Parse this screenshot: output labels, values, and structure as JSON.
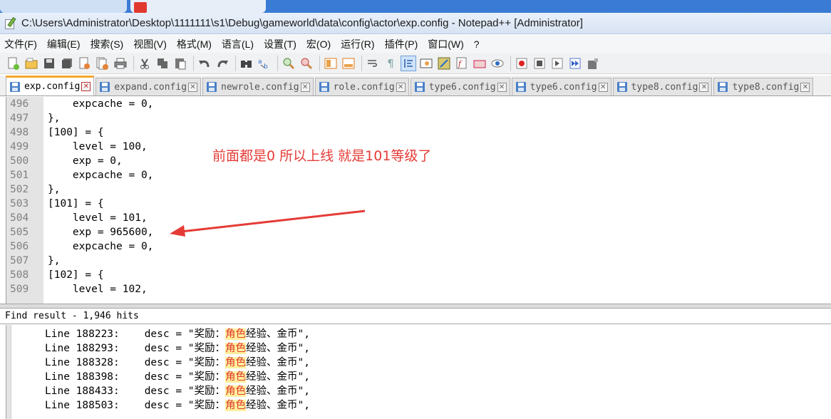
{
  "window": {
    "title": "C:\\Users\\Administrator\\Desktop\\1111111\\s1\\Debug\\gameworld\\data\\config\\actor\\exp.config - Notepad++ [Administrator]"
  },
  "menu": [
    "文件(F)",
    "编辑(E)",
    "搜索(S)",
    "视图(V)",
    "格式(M)",
    "语言(L)",
    "设置(T)",
    "宏(O)",
    "运行(R)",
    "插件(P)",
    "窗口(W)",
    "?"
  ],
  "toolbar": {
    "icons": [
      "new-file-icon",
      "open-file-icon",
      "save-icon",
      "save-all-icon",
      "close-icon",
      "close-all-icon",
      "print-icon",
      "cut-icon",
      "copy-icon",
      "paste-icon",
      "undo-icon",
      "redo-icon",
      "find-icon",
      "replace-icon",
      "zoom-in-icon",
      "zoom-out-icon",
      "sync-vertical-icon",
      "sync-horizontal-icon",
      "word-wrap-icon",
      "show-all-chars-icon",
      "indent-guide-icon",
      "user-language-icon",
      "document-map-icon",
      "function-list-icon",
      "folder-workspace-icon",
      "monitoring-icon",
      "record-macro-icon",
      "stop-macro-icon",
      "playback-macro-icon",
      "run-macro-multiple-icon",
      "save-macro-icon"
    ]
  },
  "tabs": [
    {
      "label": "exp.config",
      "active": true
    },
    {
      "label": "expand.config",
      "active": false
    },
    {
      "label": "newrole.config",
      "active": false
    },
    {
      "label": "role.config",
      "active": false
    },
    {
      "label": "type6.config",
      "active": false
    },
    {
      "label": "type6.config",
      "active": false
    },
    {
      "label": "type8.config",
      "active": false
    },
    {
      "label": "type8.config",
      "active": false
    }
  ],
  "editor": {
    "lines": [
      {
        "n": "496",
        "text": "    expcache = 0,"
      },
      {
        "n": "497",
        "text": "},"
      },
      {
        "n": "498",
        "text": "[100] = {"
      },
      {
        "n": "499",
        "text": "    level = 100,"
      },
      {
        "n": "500",
        "text": "    exp = 0,"
      },
      {
        "n": "501",
        "text": "    expcache = 0,"
      },
      {
        "n": "502",
        "text": "},"
      },
      {
        "n": "503",
        "text": "[101] = {"
      },
      {
        "n": "504",
        "text": "    level = 101,"
      },
      {
        "n": "505",
        "text": "    exp = 965600,"
      },
      {
        "n": "506",
        "text": "    expcache = 0,"
      },
      {
        "n": "507",
        "text": "},"
      },
      {
        "n": "508",
        "text": "[102] = {"
      },
      {
        "n": "509",
        "text": "    level = 102,"
      }
    ],
    "annotation": "前面都是0 所以上线 就是101等级了",
    "annotation_color": "#e53b36"
  },
  "find_result": {
    "header": "Find result - 1,946 hits",
    "highlight": "角色",
    "lines": [
      {
        "line": "Line 188223:",
        "before": "desc = \"奖励：",
        "match": "角色",
        "after": "经验、金币\","
      },
      {
        "line": "Line 188293:",
        "before": "desc = \"奖励：",
        "match": "角色",
        "after": "经验、金币\","
      },
      {
        "line": "Line 188328:",
        "before": "desc = \"奖励：",
        "match": "角色",
        "after": "经验、金币\","
      },
      {
        "line": "Line 188398:",
        "before": "desc = \"奖励：",
        "match": "角色",
        "after": "经验、金币\","
      },
      {
        "line": "Line 188433:",
        "before": "desc = \"奖励：",
        "match": "角色",
        "after": "经验、金币\","
      },
      {
        "line": "Line 188503:",
        "before": "desc = \"奖励：",
        "match": "角色",
        "after": "经验、金币\","
      }
    ]
  }
}
